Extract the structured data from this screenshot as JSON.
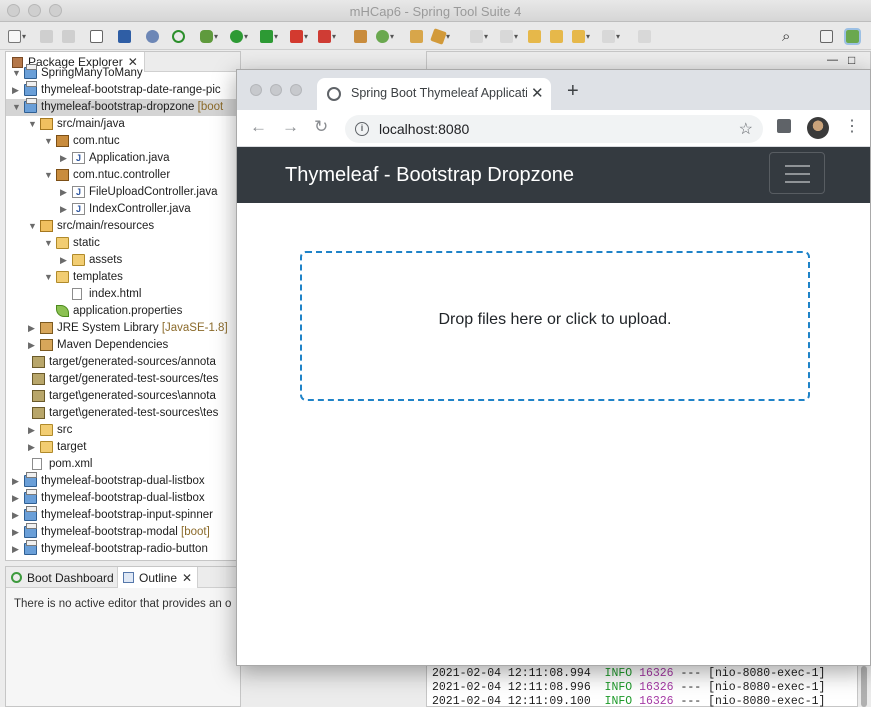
{
  "window": {
    "title": "mHCap6 - Spring Tool Suite 4"
  },
  "package_explorer": {
    "title": "Package Explorer",
    "tree": [
      {
        "label": "SpringManyToMany",
        "decoration": ""
      },
      {
        "label": "thymeleaf-bootstrap-date-range-pic",
        "decoration": ""
      },
      {
        "label": "thymeleaf-bootstrap-dropzone",
        "decoration": "[boot"
      },
      {
        "label": "src/main/java",
        "decoration": ""
      },
      {
        "label": "com.ntuc",
        "decoration": ""
      },
      {
        "label": "Application.java",
        "decoration": ""
      },
      {
        "label": "com.ntuc.controller",
        "decoration": ""
      },
      {
        "label": "FileUploadController.java",
        "decoration": ""
      },
      {
        "label": "IndexController.java",
        "decoration": ""
      },
      {
        "label": "src/main/resources",
        "decoration": ""
      },
      {
        "label": "static",
        "decoration": ""
      },
      {
        "label": "assets",
        "decoration": ""
      },
      {
        "label": "templates",
        "decoration": ""
      },
      {
        "label": "index.html",
        "decoration": ""
      },
      {
        "label": "application.properties",
        "decoration": ""
      },
      {
        "label": "JRE System Library",
        "decoration": "[JavaSE-1.8]"
      },
      {
        "label": "Maven Dependencies",
        "decoration": ""
      },
      {
        "label": "target/generated-sources/annota",
        "decoration": ""
      },
      {
        "label": "target/generated-test-sources/tes",
        "decoration": ""
      },
      {
        "label": "target\\generated-sources\\annota",
        "decoration": ""
      },
      {
        "label": "target\\generated-test-sources\\tes",
        "decoration": ""
      },
      {
        "label": "src",
        "decoration": ""
      },
      {
        "label": "target",
        "decoration": ""
      },
      {
        "label": "pom.xml",
        "decoration": ""
      },
      {
        "label": "thymeleaf-bootstrap-dual-listbox",
        "decoration": ""
      },
      {
        "label": "thymeleaf-bootstrap-dual-listbox",
        "decoration": ""
      },
      {
        "label": "thymeleaf-bootstrap-input-spinner",
        "decoration": ""
      },
      {
        "label": "thymeleaf-bootstrap-modal",
        "decoration": "[boot]"
      },
      {
        "label": "thymeleaf-bootstrap-radio-button",
        "decoration": ""
      }
    ]
  },
  "bottom_views": {
    "boot_dashboard": "Boot Dashboard",
    "outline": "Outline",
    "outline_message": "There is no active editor that provides an o"
  },
  "console": {
    "lines": [
      {
        "ts": "2021-02-04 12:11:08.994",
        "level": "INFO",
        "pid": "16326",
        "rest": " --- [nio-8080-exec-1]"
      },
      {
        "ts": "2021-02-04 12:11:08.996",
        "level": "INFO",
        "pid": "16326",
        "rest": " --- [nio-8080-exec-1]"
      },
      {
        "ts": "2021-02-04 12:11:09.100",
        "level": "INFO",
        "pid": "16326",
        "rest": " --- [nio-8080-exec-1]"
      }
    ]
  },
  "browser": {
    "tab_title": "Spring Boot Thymeleaf Application",
    "url": "localhost:8080",
    "page": {
      "brand": "Thymeleaf - Bootstrap Dropzone",
      "dropzone_message": "Drop files here or click to upload."
    }
  },
  "colors": {
    "navbar": "#343a40",
    "dropzone_border": "#1f83c8",
    "log_info": "#1e9a2a",
    "log_pid": "#a53aa5"
  }
}
